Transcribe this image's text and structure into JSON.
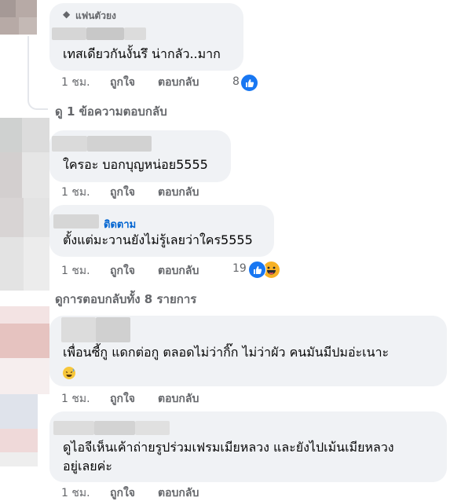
{
  "comments": [
    {
      "badge_label": "แฟนตัวยง",
      "text": "เทสเดียวกันงั้นรึ น่ากลัว..มาก",
      "time": "1 ชม.",
      "like_label": "ถูกใจ",
      "reply_label": "ตอบกลับ",
      "reaction_count": "8",
      "reaction_icons": [
        "like-icon"
      ]
    },
    {
      "text": "ใครอะ บอกบุญหน่อย5555",
      "time": "1 ชม.",
      "like_label": "ถูกใจ",
      "reply_label": "ตอบกลับ"
    },
    {
      "follow_label": "ติดตาม",
      "text": "ตั้งแต่มะวานยังไม่รู้เลยว่าใคร5555",
      "time": "1 ชม.",
      "like_label": "ถูกใจ",
      "reply_label": "ตอบกลับ",
      "reaction_count": "19",
      "reaction_icons": [
        "like-icon",
        "laugh-icon"
      ]
    },
    {
      "text": "เพื่อนซี้กู แดกต่อกู ตลอดไม่ว่ากิ๊ก ไม่ว่าผัว คนมันมีปมอ่ะเนาะ",
      "emoji": "sweat-smile-emoji",
      "time": "1 ชม.",
      "like_label": "ถูกใจ",
      "reply_label": "ตอบกลับ"
    },
    {
      "text_line1": "ดูไอจีเห็นเค้าถ่ายรูปร่วมเฟรมเมียหลวง และยังไปเม้นเมียหลวง",
      "text_line2": "อยู่เลยค่ะ",
      "time": "1 ชม.",
      "like_label": "ถูกใจ",
      "reply_label": "ตอบกลับ"
    }
  ],
  "view_replies": "ดู 1 ข้อความตอบกลับ",
  "view_all_replies": "ดูการตอบกลับทั้ง 8 รายการ",
  "colors": {
    "bubble": "#f0f2f5",
    "secondary_text": "#65676b",
    "link": "#0064d1",
    "like_blue": "#1877f2"
  }
}
